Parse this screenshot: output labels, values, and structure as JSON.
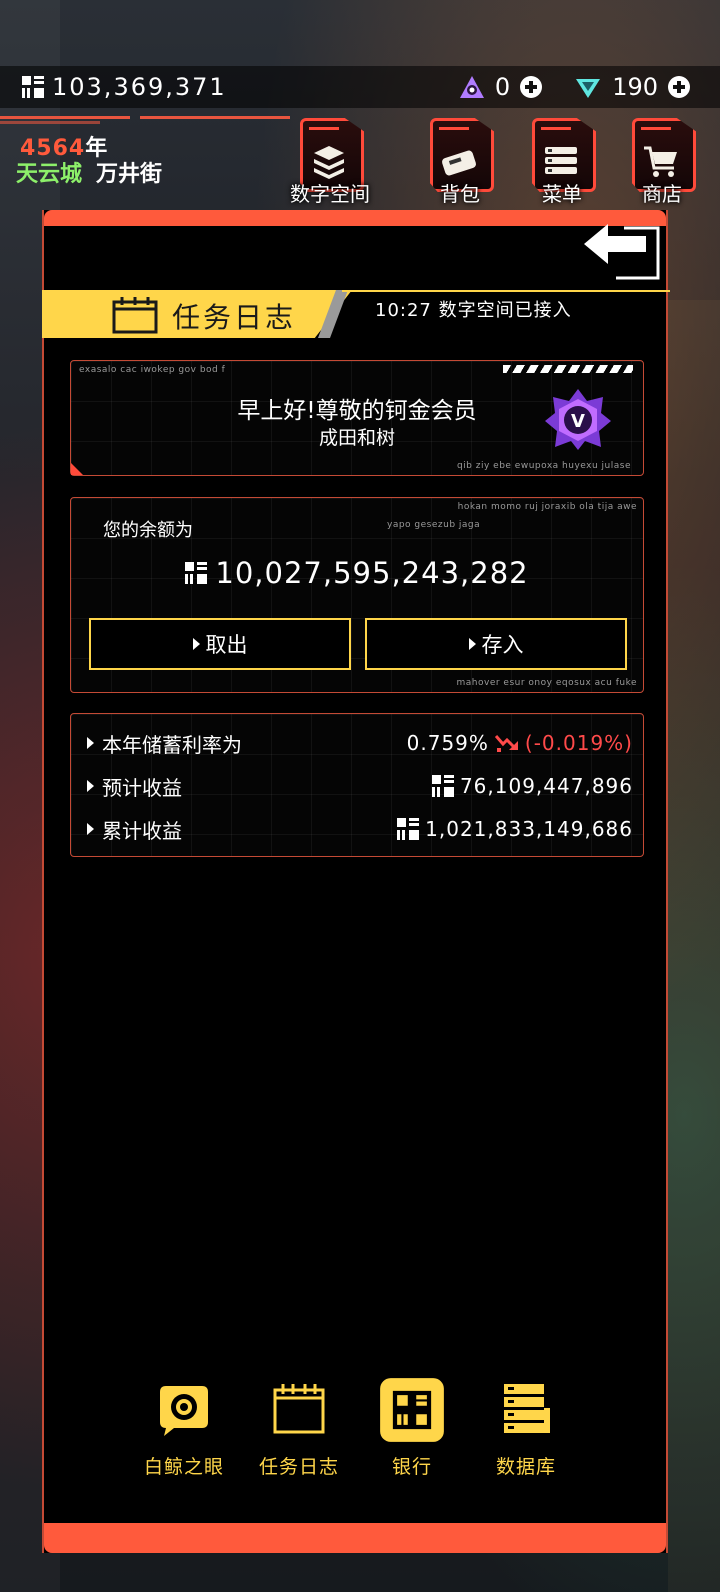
{
  "topbar": {
    "money": "103,369,371",
    "gem_a_count": "0",
    "gem_b_count": "190"
  },
  "location": {
    "year_num": "4564",
    "year_suffix": "年",
    "city": "天云城",
    "street": "万井街"
  },
  "top_nav": [
    {
      "label": "数字空间",
      "icon": "layers-icon"
    },
    {
      "label": "背包",
      "icon": "bag-icon"
    },
    {
      "label": "菜单",
      "icon": "menu-icon"
    },
    {
      "label": "商店",
      "icon": "cart-icon"
    }
  ],
  "header": {
    "title": "任务日志",
    "status": "10:27 数字空间已接入"
  },
  "greeting": {
    "deco_top": "exasalo cac iwokep gov bod f",
    "line1": "早上好!尊敬的钶金会员",
    "line2": "成田和树",
    "deco_bottom": "qib ziy ebe ewupoxa huyexu julase"
  },
  "balance": {
    "deco_top": "hokan momo ruj joraxib ola tija awe",
    "deco_mid": "yapo gesezub jaga",
    "label": "您的余额为",
    "amount": "10,027,595,243,282",
    "withdraw": "取出",
    "deposit": "存入",
    "deco_bottom": "mahover esur onoy eqosux acu fuke"
  },
  "rates": {
    "rate_label": "本年储蓄利率为",
    "rate_value": "0.759%",
    "rate_change": "(-0.019%)",
    "expected_label": "预计收益",
    "expected_value": "76,109,447,896",
    "total_label": "累计收益",
    "total_value": "1,021,833,149,686"
  },
  "bottom_nav": [
    {
      "label": "白鲸之眼",
      "icon": "eye-icon"
    },
    {
      "label": "任务日志",
      "icon": "calendar-icon"
    },
    {
      "label": "银行",
      "icon": "bank-icon",
      "active": true
    },
    {
      "label": "数据库",
      "icon": "database-icon"
    }
  ],
  "colors": {
    "accent_red": "#ff5a3c",
    "accent_yellow": "#ffd64a",
    "city_green": "#8df06a",
    "negative": "#ff4a4a"
  }
}
